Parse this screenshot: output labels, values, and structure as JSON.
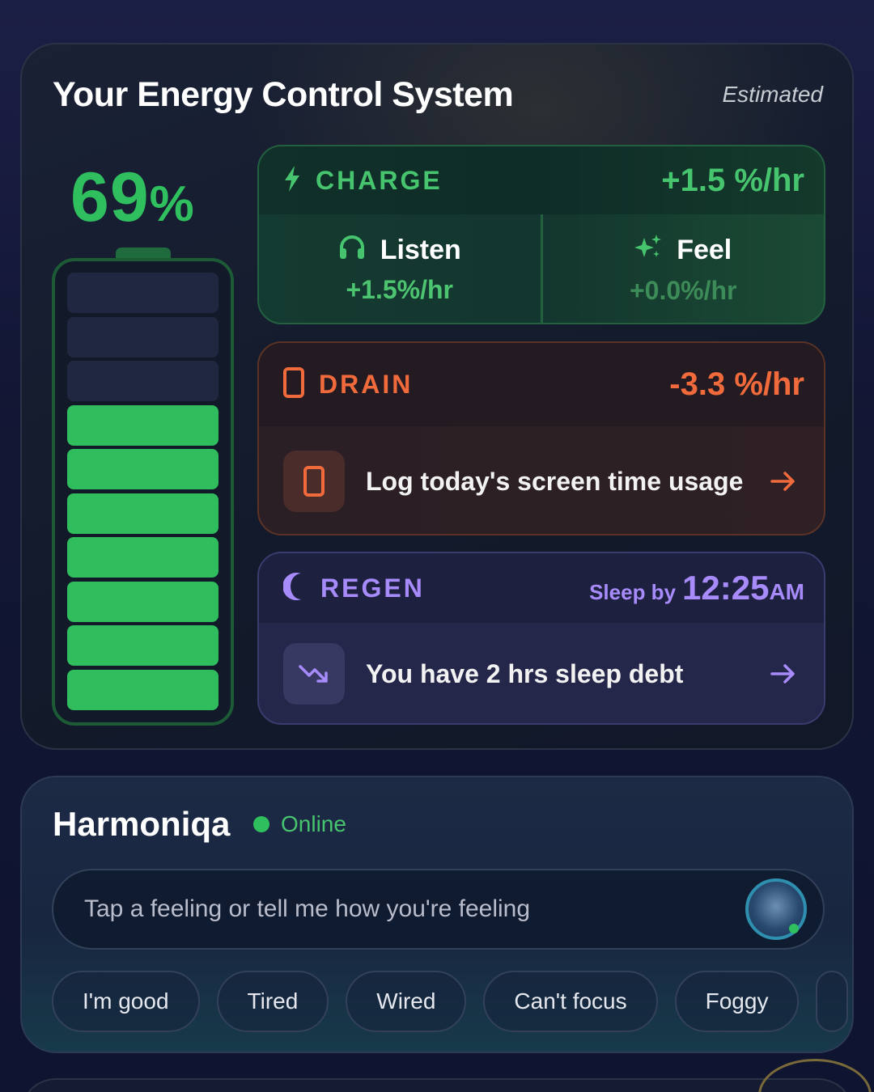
{
  "energy": {
    "title": "Your Energy Control System",
    "estimated_label": "Estimated",
    "battery": {
      "percent_value": "69",
      "percent_symbol": "%",
      "level": 0.69,
      "segments_total": 10,
      "segments_filled": 7,
      "fill_color": "#2fbd5e"
    },
    "charge": {
      "title": "CHARGE",
      "rate": "+1.5 %/hr",
      "color": "#47c46e",
      "items": [
        {
          "label": "Listen",
          "value": "+1.5%/hr",
          "icon": "headphones-icon"
        },
        {
          "label": "Feel",
          "value": "+0.0%/hr",
          "icon": "sparkle-icon"
        }
      ]
    },
    "drain": {
      "title": "DRAIN",
      "rate": "-3.3 %/hr",
      "color": "#f06a3c",
      "action_text": "Log today's screen time usage",
      "icon": "phone-icon"
    },
    "regen": {
      "title": "REGEN",
      "sleep_label": "Sleep by",
      "sleep_time": "12:25",
      "sleep_ampm": "AM",
      "color": "#a78bfa",
      "action_text": "You have 2 hrs sleep debt",
      "icon": "moon-icon"
    }
  },
  "assistant": {
    "name": "Harmoniqa",
    "status": "Online",
    "input_placeholder": "Tap a feeling or tell me how you're feeling",
    "chips": [
      "I'm good",
      "Tired",
      "Wired",
      "Can't focus",
      "Foggy"
    ]
  }
}
